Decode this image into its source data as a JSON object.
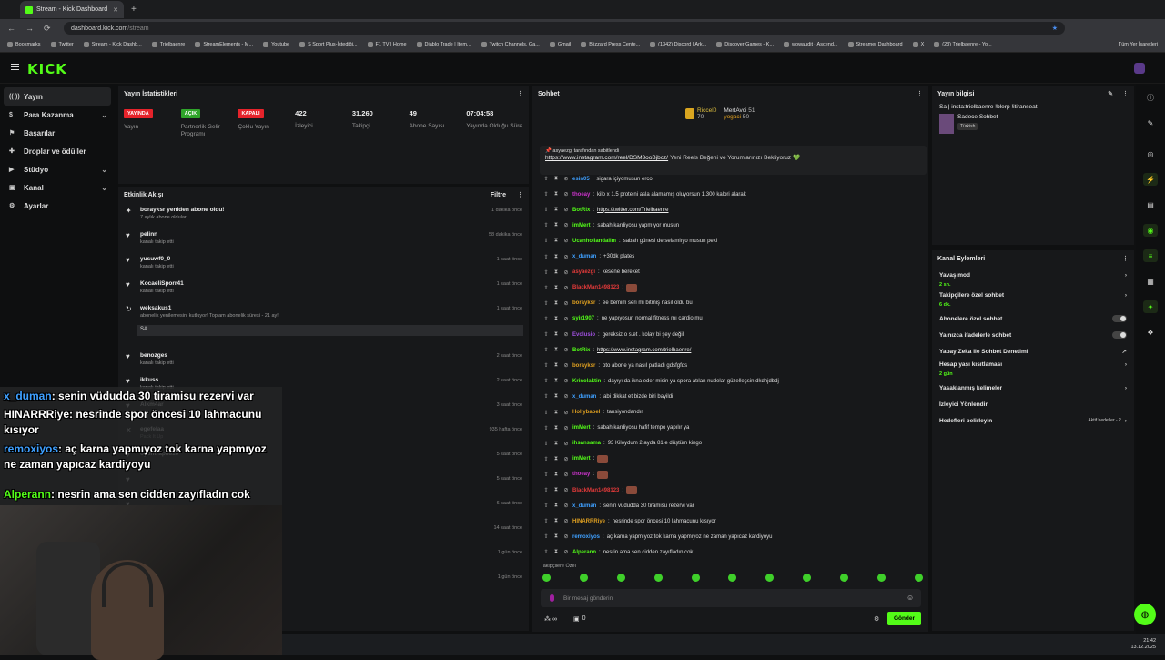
{
  "browser": {
    "tab_title": "Stream - Kick Dashboard",
    "url_host": "dashboard.kick.com",
    "url_path": "/stream",
    "bookmarks": [
      "Bookmarks",
      "Twitter",
      "Stream - Kick Dashb...",
      "Trielbaenre",
      "StreamElements - M...",
      "Youtube",
      "S Sport Plus-İstediği...",
      "F1 TV | Home",
      "Diablo Trade | Item...",
      "Twitch Channels, Ga...",
      "Gmail",
      "Blizzard Press Cente...",
      "(1342) Discord | Ark...",
      "Discover Games - K...",
      "wowaudit - Ascend...",
      "Streamer Dashboard",
      "X",
      "(23) Trielbaenre - Yo..."
    ],
    "all_bookmarks": "Tüm Yer İşaretleri"
  },
  "sidebar": {
    "items": [
      {
        "label": "Yayın"
      },
      {
        "label": "Para Kazanma"
      },
      {
        "label": "Başarılar"
      },
      {
        "label": "Droplar ve ödüller"
      },
      {
        "label": "Stüdyo"
      },
      {
        "label": "Kanal"
      },
      {
        "label": "Ayarlar"
      }
    ]
  },
  "stats": {
    "title": "Yayın İstatistikleri",
    "items": [
      {
        "badge": "YAYINDA",
        "badge_color": "#e6232b",
        "label": "Yayın"
      },
      {
        "badge": "AÇIK",
        "badge_color": "#2fa52a",
        "label": "Partnerlik Gelir Programı"
      },
      {
        "badge": "KAPALI",
        "badge_color": "#e6232b",
        "label": "Çoklu Yayın"
      },
      {
        "value": "422",
        "label": "İzleyici"
      },
      {
        "value": "31.260",
        "label": "Takipçi"
      },
      {
        "value": "49",
        "label": "Abone Sayısı"
      },
      {
        "value": "07:04:58",
        "label": "Yayında Olduğu Süre"
      }
    ]
  },
  "events": {
    "title": "Etkinlik Akışı",
    "filter": "Filtre",
    "items": [
      {
        "name": "borayksr yeniden abone oldu!",
        "sub": "7 aylık abone oldular",
        "time": "1 dakika önce"
      },
      {
        "name": "pelinn",
        "sub": "kanalı takip etti",
        "time": "58 dakika önce"
      },
      {
        "name": "yusuwf0_0",
        "sub": "kanalı takip etti",
        "time": "1 saat önce"
      },
      {
        "name": "KocaeliSporr41",
        "sub": "kanalı takip etti",
        "time": "1 saat önce"
      },
      {
        "name": "weksakus1",
        "sub": "abonelik yenilemesini kutluyor! Toplam abonelik süresi - 21 ay!",
        "time": "1 saat önce",
        "note": "SA"
      },
      {
        "name": "benozges",
        "sub": "kanalı takip etti",
        "time": "2 saat önce"
      },
      {
        "name": "ikkuss",
        "sub": "kanalı takip etti",
        "time": "2 saat önce"
      },
      {
        "name": "Alkm4ar",
        "sub": "",
        "time": "3 saat önce"
      },
      {
        "name": "egefelaa",
        "sub": "Pack It Up",
        "time": "935 hafta önce"
      },
      {
        "name": "oyuntrap8810",
        "sub": "",
        "time": "5 saat önce"
      },
      {
        "name": "",
        "sub": "",
        "time": "5 saat önce"
      },
      {
        "name": "",
        "sub": "",
        "time": "6 saat önce"
      },
      {
        "name": "",
        "sub": "",
        "time": "14 saat önce"
      },
      {
        "name": "",
        "sub": "",
        "time": "1 gün önce"
      },
      {
        "name": "",
        "sub": "",
        "time": "1 gün önce"
      }
    ]
  },
  "chat": {
    "title": "Sohbet",
    "leaders": [
      {
        "name": "Riccel0",
        "count": "70"
      },
      {
        "name": "MertAvci",
        "count": "51"
      },
      {
        "name": "yogaci",
        "count": "50"
      }
    ],
    "pinned_by": "asyaezgi tarafından sabitlendi",
    "pinned_link": "https://www.instagram.com/reel/DSM3ooBjbcz/",
    "pinned_text": "Yeni Reels Beğeni ve Yorumlarınızı Bekliyoruz 💚",
    "messages": [
      {
        "user": "esin05",
        "color": "#3fa0ff",
        "text": "sigara içiyomusun erco"
      },
      {
        "user": "thoeay",
        "color": "#cc33cc",
        "text": "kilo x 1.5 proteini asla alamamış oluyorsun 1.300 kalori alarak"
      },
      {
        "user": "BotRix",
        "color": "#53fc18",
        "text": "https://twitter.com/Trielbaenre",
        "link": true
      },
      {
        "user": "imMert",
        "color": "#53fc18",
        "text": "sabah kardiyosu yapmıyor musun"
      },
      {
        "user": "Ucanhollandalim",
        "color": "#53fc18",
        "text": "sabah güneşi de selamlıyo musun peki"
      },
      {
        "user": "x_duman",
        "color": "#3fa0ff",
        "text": "+30dk plates"
      },
      {
        "user": "asyaezgi",
        "color": "#e33a3a",
        "text": "kesene bereket"
      },
      {
        "user": "BlackMan1498123",
        "color": "#e33a3a",
        "text": "",
        "emote": true
      },
      {
        "user": "borayksr",
        "color": "#e0a020",
        "text": "ee bemim seri mi bitmiş nasıl oldu bu"
      },
      {
        "user": "syir1907",
        "color": "#53fc18",
        "text": "ne yapıyosun normal fitness mı cardio mu"
      },
      {
        "user": "Evolusio",
        "color": "#a050e0",
        "text": "gereksiz o s.et . kolay bi şey değil"
      },
      {
        "user": "BotRix",
        "color": "#53fc18",
        "text": "https://www.instagram.com/trielbaenre/",
        "link": true
      },
      {
        "user": "borayksr",
        "color": "#e0a020",
        "text": "oto abone ya nasıl patladı gdsfgfds"
      },
      {
        "user": "Krinolaktin",
        "color": "#53fc18",
        "text": "dayıyı da ikna eder misin ya spora atılan nudelar güzelleşsin dkdnjdbdj"
      },
      {
        "user": "x_duman",
        "color": "#3fa0ff",
        "text": "abi dikkat et bizde biri bayildi"
      },
      {
        "user": "Hollybabel",
        "color": "#e0a020",
        "text": "tansiyondandır"
      },
      {
        "user": "imMert",
        "color": "#53fc18",
        "text": "sabah kardiyosu hafif tempo yapılır ya"
      },
      {
        "user": "ihsansama",
        "color": "#53fc18",
        "text": "93 Kiloydum 2 ayda 81 e düştüm kingo"
      },
      {
        "user": "imMert",
        "color": "#53fc18",
        "text": "",
        "emote": true
      },
      {
        "user": "thoeay",
        "color": "#cc33cc",
        "text": "",
        "emote": true
      },
      {
        "user": "BlackMan1498123",
        "color": "#e33a3a",
        "text": "",
        "emote": true
      },
      {
        "user": "x_duman",
        "color": "#3fa0ff",
        "text": "senin vüdudda 30 tiramisu rezervi var"
      },
      {
        "user": "HINARRRiye",
        "color": "#e0a020",
        "text": "nesrinde spor öncesi 10 lahmacunu kısıyor"
      },
      {
        "user": "remoxiyos",
        "color": "#3fa0ff",
        "text": "aç karna yapmıyoz tok karna yapmıyoz ne zaman yapıcaz kardiyoyu"
      },
      {
        "user": "Alperann",
        "color": "#53fc18",
        "text": "nesrin ama sen cidden zayıfladın cok"
      }
    ],
    "mode_label": "Takipçilere Özel",
    "input_placeholder": "Bir mesaj gönderin",
    "points": "0",
    "send_label": "Gönder"
  },
  "stream_info": {
    "title": "Yayın bilgisi",
    "stream_title": "Sa | insta:trielbaenre !blerp !itiranseat",
    "category": "Sadece Sohbet",
    "language": "Türkish"
  },
  "channel_actions": {
    "title": "Kanal Eylemleri",
    "items": [
      {
        "label": "Yavaş mod",
        "sub": "2 sn.",
        "type": "arrow"
      },
      {
        "label": "Takipçilere özel sohbet",
        "sub": "6 dk.",
        "type": "arrow"
      },
      {
        "label": "Abonelere özel sohbet",
        "type": "toggle"
      },
      {
        "label": "Yalnızca ifadelerle sohbet",
        "type": "toggle"
      },
      {
        "label": "Yapay Zeka ile Sohbet Denetimi",
        "type": "ext"
      },
      {
        "label": "Hesap yaşı kısıtlaması",
        "sub": "2 gün",
        "type": "arrow"
      },
      {
        "label": "Yasaklanmış kelimeler",
        "type": "arrow"
      },
      {
        "label": "İzleyici Yönlendir",
        "type": "none"
      },
      {
        "label": "Hedefleri belirleyin",
        "right": "Aktif hedefler - 2",
        "type": "arrow"
      }
    ]
  },
  "overlay_chat": [
    {
      "user": "x_duman",
      "color": "#3fa0ff",
      "text": ": senin vüdudda 30 tiramisu rezervi var"
    },
    {
      "user": "HINARRRiye",
      "color": "#ffffff",
      "text": ": nesrinde spor öncesi 10 lahmacunu kısıyor"
    },
    {
      "user": "remoxiyos",
      "color": "#3fa0ff",
      "text": ": aç karna yapmıyoz tok karna yapmıyoz ne zaman yapıcaz kardiyoyu"
    },
    {
      "user": "Alperann",
      "color": "#53fc18",
      "text": ": nesrin ama sen cidden zayıfladın cok"
    }
  ],
  "taskbar": {
    "time": "21:42",
    "date": "13.12.2025"
  },
  "colors": {
    "accent": "#53fc18",
    "bg": "#0f1011",
    "panel": "#17181a",
    "live": "#e6232b"
  }
}
